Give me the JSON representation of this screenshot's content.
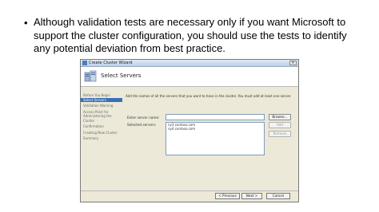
{
  "slide": {
    "bullet_symbol": "•",
    "bullet_text": "Although validation tests are necessary only if you want Microsoft to support the cluster configuration, you should use the tests to identify any potential deviation from best practice."
  },
  "dialog": {
    "title": "Create Cluster Wizard",
    "close_symbol": "×",
    "header_title": "Select Servers",
    "nav_items": [
      {
        "label": "Before You Begin"
      },
      {
        "label": "Select Servers"
      },
      {
        "label": "Validation Warning"
      },
      {
        "label": "Access Point for Administering the Cluster"
      },
      {
        "label": "Confirmation"
      },
      {
        "label": "Creating New Cluster"
      },
      {
        "label": "Summary"
      }
    ],
    "instruction": "Add the names of all the servers that you want to have in the cluster. You must add at least one server.",
    "server_name_label": "Enter server name:",
    "selected_servers_label": "Selected servers:",
    "selected_servers": [
      "ny3.contoso.com",
      "ny4.contoso.com"
    ],
    "browse_button": "Browse...",
    "add_button": "Add",
    "remove_button": "Remove",
    "previous_button": "< Previous",
    "next_button": "Next >",
    "cancel_button": "Cancel"
  }
}
